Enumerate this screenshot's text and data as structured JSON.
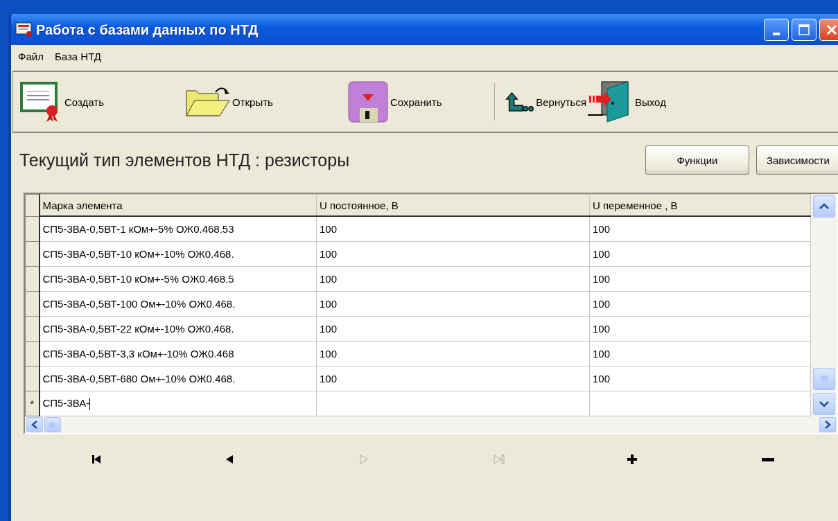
{
  "window": {
    "title": "Работа с базами данных по НТД"
  },
  "menu": [
    "Файл",
    "База НТД"
  ],
  "toolbar": [
    {
      "kind": "create",
      "label": "Создать"
    },
    {
      "kind": "open",
      "label": "Открыть"
    },
    {
      "kind": "save",
      "label": "Сохранить"
    },
    {
      "kind": "separator"
    },
    {
      "kind": "back",
      "label": "Вернуться"
    },
    {
      "kind": "exit",
      "label": "Выход"
    }
  ],
  "heading": "Текущий тип элементов НТД : резисторы",
  "buttons": [
    "Функции",
    "Зависимости"
  ],
  "table": {
    "columns": [
      "Марка элемента",
      "U постоянное, В",
      "U переменное , В"
    ],
    "rows": [
      {
        "editing": false,
        "cells": [
          "СП5-3ВА-0,5ВТ-1 кОм+-5% ОЖ0.468.53",
          "100",
          "100"
        ]
      },
      {
        "editing": false,
        "cells": [
          "СП5-3ВА-0,5ВТ-10 кОм+-10% ОЖ0.468.",
          "100",
          "100"
        ]
      },
      {
        "editing": false,
        "cells": [
          "СП5-3ВА-0,5ВТ-10 кОм+-5% ОЖ0.468.5",
          "100",
          "100"
        ]
      },
      {
        "editing": false,
        "cells": [
          "СП5-3ВА-0,5ВТ-100 Ом+-10% ОЖ0.468.",
          "100",
          "100"
        ]
      },
      {
        "editing": false,
        "cells": [
          "СП5-3ВА-0,5ВТ-22 кОм+-10% ОЖ0.468.",
          "100",
          "100"
        ]
      },
      {
        "editing": false,
        "cells": [
          "СП5-3ВА-0,5ВТ-3,3 кОм+-10% ОЖ0.468",
          "100",
          "100"
        ]
      },
      {
        "editing": false,
        "cells": [
          "СП5-3ВА-0,5ВТ-680 Ом+-10% ОЖ0.468.",
          "100",
          "100"
        ]
      },
      {
        "editing": true,
        "indicator": "*",
        "cells": [
          "СП5-3ВА-",
          "",
          ""
        ]
      }
    ]
  },
  "navigator": [
    {
      "kind": "first",
      "disabled": false
    },
    {
      "kind": "prior",
      "disabled": false
    },
    {
      "kind": "next",
      "disabled": true
    },
    {
      "kind": "last",
      "disabled": true
    },
    {
      "kind": "insert",
      "disabled": false
    },
    {
      "kind": "delete",
      "disabled": false
    }
  ]
}
